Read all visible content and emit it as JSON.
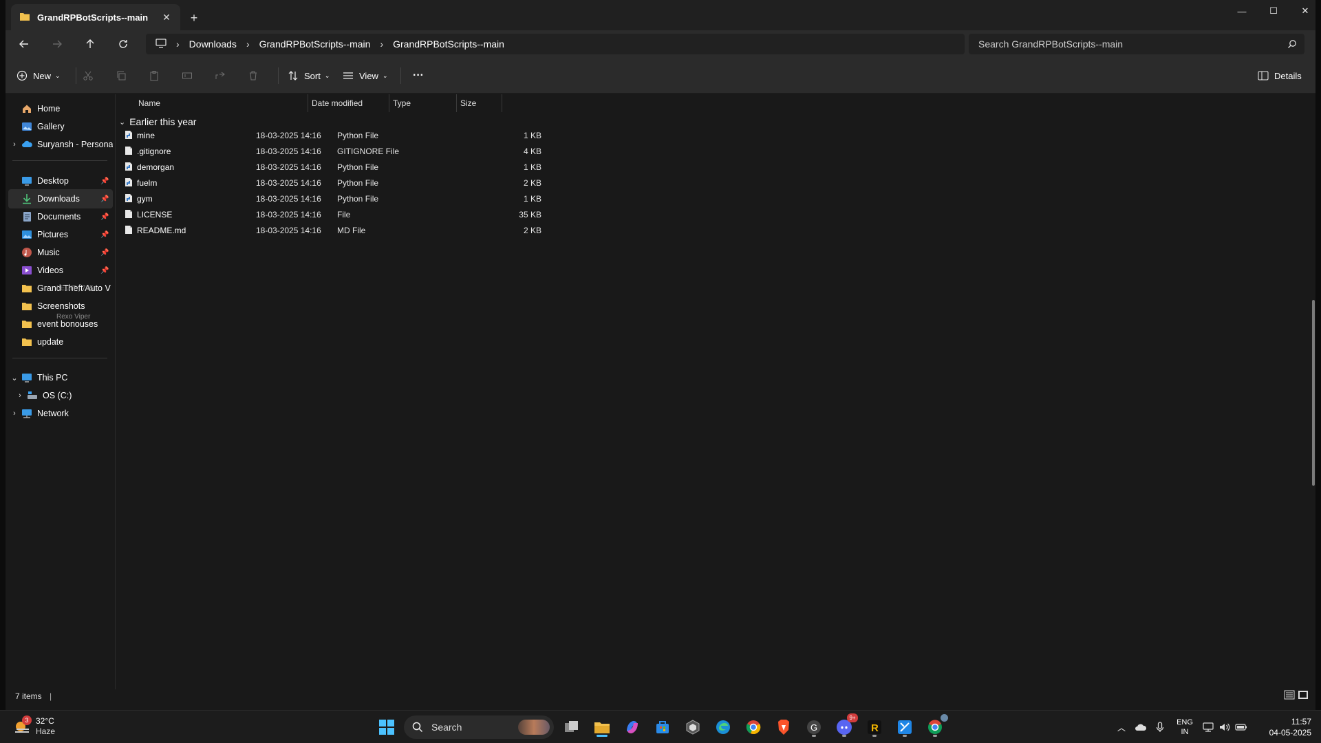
{
  "window": {
    "tab_title": "GrandRPBotScripts--main",
    "controls": {
      "minimize": "—",
      "maximize": "☐",
      "close": "✕"
    }
  },
  "address": {
    "crumbs": [
      "Downloads",
      "GrandRPBotScripts--main",
      "GrandRPBotScripts--main"
    ],
    "search_placeholder": "Search GrandRPBotScripts--main"
  },
  "commandbar": {
    "new_label": "New",
    "sort_label": "Sort",
    "view_label": "View",
    "more_label": "···",
    "details_label": "Details"
  },
  "sidebar": {
    "quick": [
      {
        "label": "Home",
        "icon": "home-icon"
      },
      {
        "label": "Gallery",
        "icon": "gallery-icon"
      },
      {
        "label": "Suryansh - Persona",
        "icon": "onedrive-icon"
      }
    ],
    "pinned": [
      {
        "label": "Desktop",
        "icon": "desktop-icon"
      },
      {
        "label": "Downloads",
        "icon": "downloads-icon"
      },
      {
        "label": "Documents",
        "icon": "documents-icon"
      },
      {
        "label": "Pictures",
        "icon": "pictures-icon"
      },
      {
        "label": "Music",
        "icon": "music-icon"
      },
      {
        "label": "Videos",
        "icon": "videos-icon"
      },
      {
        "label": "Grand Theft Auto V",
        "icon": "folder-icon"
      },
      {
        "label": "Screenshots",
        "icon": "folder-icon"
      },
      {
        "label": "event bonouses",
        "icon": "folder-icon"
      },
      {
        "label": "update",
        "icon": "folder-icon"
      }
    ],
    "this_pc": "This PC",
    "os_drive": "OS (C:)",
    "network": "Network",
    "overlay_text_1": "LEGIT | 745",
    "overlay_text_2": "Rexo Viper"
  },
  "filelist": {
    "columns": {
      "name": "Name",
      "date": "Date modified",
      "type": "Type",
      "size": "Size"
    },
    "group": "Earlier this year",
    "rows": [
      {
        "name": "mine",
        "date": "18-03-2025 14:16",
        "type": "Python File",
        "size": "1 KB",
        "icon": "python-file-icon"
      },
      {
        "name": ".gitignore",
        "date": "18-03-2025 14:16",
        "type": "GITIGNORE File",
        "size": "4 KB",
        "icon": "file-icon"
      },
      {
        "name": "demorgan",
        "date": "18-03-2025 14:16",
        "type": "Python File",
        "size": "1 KB",
        "icon": "python-file-icon"
      },
      {
        "name": "fuelm",
        "date": "18-03-2025 14:16",
        "type": "Python File",
        "size": "2 KB",
        "icon": "python-file-icon"
      },
      {
        "name": "gym",
        "date": "18-03-2025 14:16",
        "type": "Python File",
        "size": "1 KB",
        "icon": "python-file-icon"
      },
      {
        "name": "LICENSE",
        "date": "18-03-2025 14:16",
        "type": "File",
        "size": "35 KB",
        "icon": "file-icon"
      },
      {
        "name": "README.md",
        "date": "18-03-2025 14:16",
        "type": "MD File",
        "size": "2 KB",
        "icon": "file-icon"
      }
    ]
  },
  "status": {
    "items": "7 items"
  },
  "taskbar": {
    "weather_temp": "32°C",
    "weather_desc": "Haze",
    "weather_badge": "3",
    "search_label": "Search",
    "discord_badge": "9+",
    "lang_1": "ENG",
    "lang_2": "IN",
    "time": "11:57",
    "date": "04-05-2025"
  },
  "colors": {
    "accent": "#4cc2ff",
    "folder": "#f2c14e",
    "bg": "#191919"
  }
}
